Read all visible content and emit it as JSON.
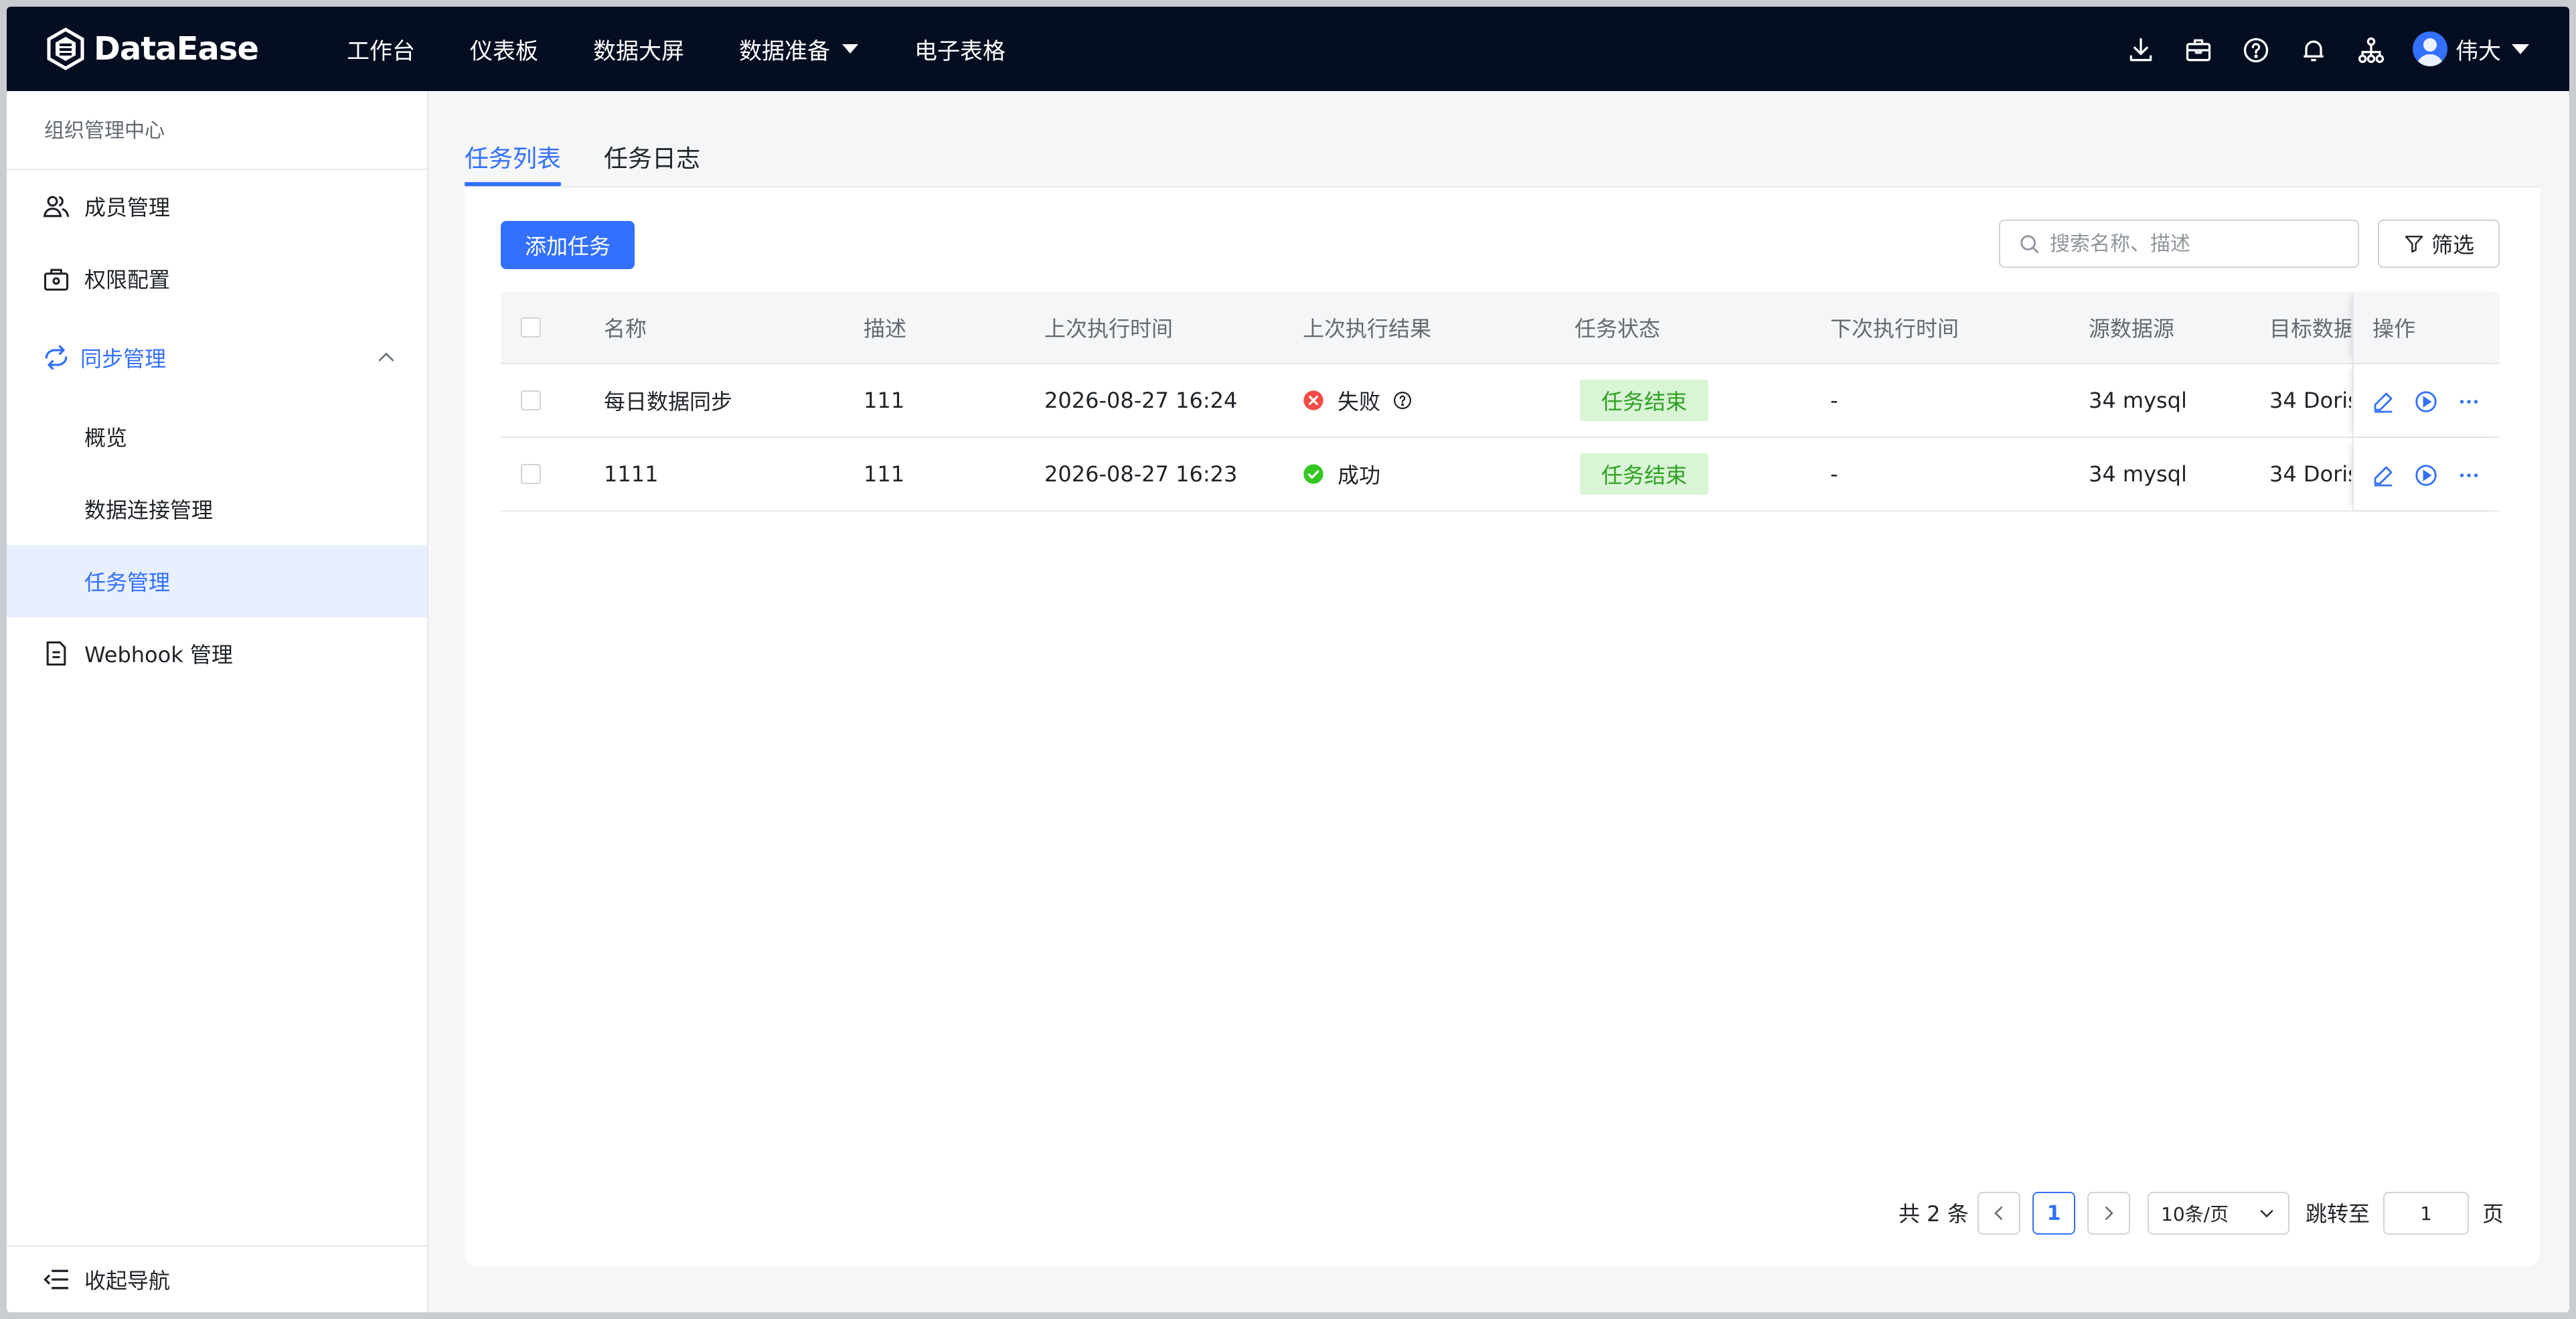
{
  "header": {
    "brand": "DataEase",
    "nav": [
      {
        "label": "工作台"
      },
      {
        "label": "仪表板"
      },
      {
        "label": "数据大屏"
      },
      {
        "label": "数据准备",
        "has_dropdown": true
      },
      {
        "label": "电子表格"
      }
    ],
    "icons": [
      "download-icon",
      "toolbox-icon",
      "help-icon",
      "bell-icon",
      "org-tree-icon"
    ],
    "user_name": "伟大"
  },
  "sidebar": {
    "title": "组织管理中心",
    "items": [
      {
        "label": "成员管理",
        "icon": "users-icon"
      },
      {
        "label": "权限配置",
        "icon": "lock-bag-icon"
      },
      {
        "label": "同步管理",
        "icon": "sync-icon",
        "expanded": true
      },
      {
        "label": "概览"
      },
      {
        "label": "数据连接管理"
      },
      {
        "label": "任务管理",
        "active": true
      },
      {
        "label": "Webhook 管理",
        "icon": "document-icon"
      }
    ],
    "collapse_label": "收起导航"
  },
  "tabs": [
    {
      "label": "任务列表",
      "active": true
    },
    {
      "label": "任务日志"
    }
  ],
  "toolbar": {
    "add_label": "添加任务",
    "search_placeholder": "搜索名称、描述",
    "filter_label": "筛选"
  },
  "table": {
    "columns": [
      "名称",
      "描述",
      "上次执行时间",
      "上次执行结果",
      "任务状态",
      "下次执行时间",
      "源数据源",
      "目标数据源",
      "操作"
    ],
    "rows": [
      {
        "name": "每日数据同步",
        "desc": "111",
        "last_time": "2026-08-27 16:24",
        "result": "失败",
        "result_status": "error",
        "status": "任务结束",
        "next_time": "-",
        "source": "34 mysql",
        "target": "34 Doris"
      },
      {
        "name": "1111",
        "desc": "111",
        "last_time": "2026-08-27 16:23",
        "result": "成功",
        "result_status": "success",
        "status": "任务结束",
        "next_time": "-",
        "source": "34 mysql",
        "target": "34 Doris"
      }
    ]
  },
  "pagination": {
    "total_label": "共 2 条",
    "current_page": "1",
    "page_size": "10条/页",
    "jump_label": "跳转至",
    "jump_value": "1",
    "page_unit": "页"
  },
  "colors": {
    "accent": "#3370ff",
    "header_bg": "#050e21",
    "success": "#34c724",
    "error": "#f54a45",
    "tag_bg": "#d9f5d6",
    "tag_text": "#2ea121"
  }
}
